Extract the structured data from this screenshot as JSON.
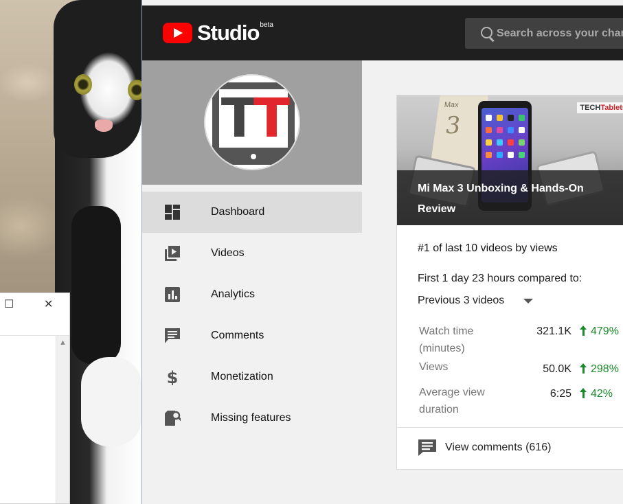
{
  "app": {
    "logo_text": "Studio",
    "beta_label": "beta",
    "search_placeholder": "Search across your channel"
  },
  "channel": {
    "avatar_letters": [
      "T",
      "T"
    ]
  },
  "nav": {
    "items": [
      {
        "label": "Dashboard",
        "icon": "dashboard-icon",
        "active": true
      },
      {
        "label": "Videos",
        "icon": "videos-icon",
        "active": false
      },
      {
        "label": "Analytics",
        "icon": "analytics-icon",
        "active": false
      },
      {
        "label": "Comments",
        "icon": "comments-icon",
        "active": false
      },
      {
        "label": "Monetization",
        "icon": "dollar-icon",
        "active": false
      },
      {
        "label": "Missing features",
        "icon": "missing-features-icon",
        "active": false
      }
    ]
  },
  "video_card": {
    "title": "Mi Max 3 Unboxing & Hands-On Review",
    "thumbnail_brand_a": "TECH",
    "thumbnail_brand_b": "Tablets",
    "thumbnail_box_label": "Max",
    "thumbnail_box_number": "3",
    "rank_text": "#1 of last 10 videos by views",
    "compare_label": "First 1 day 23 hours compared to:",
    "compare_value": "Previous 3 videos",
    "metrics": [
      {
        "label": "Watch time (minutes)",
        "value": "321.1K",
        "change": "479%"
      },
      {
        "label": "Views",
        "value": "50.0K",
        "change": "298%"
      },
      {
        "label": "Average view duration",
        "value": "6:25",
        "change": "42%"
      }
    ],
    "view_comments_label": "View comments (616)"
  },
  "side_window": {
    "maximize_glyph": "☐",
    "close_glyph": "✕",
    "scroll_up_glyph": "▲"
  },
  "colors": {
    "brand_red": "#ff0000",
    "topbar": "#1f1f1f",
    "positive": "#1a8a2a",
    "nav_active": "#dcdcdc"
  }
}
